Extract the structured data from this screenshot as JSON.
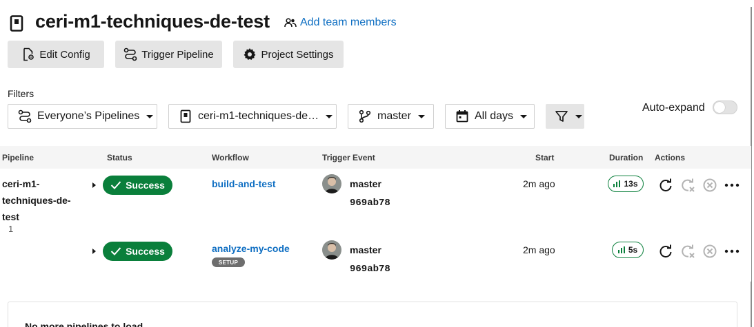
{
  "header": {
    "project_title": "ceri-m1-techniques-de-test",
    "add_team_label": "Add team members",
    "buttons": {
      "edit_config": "Edit Config",
      "trigger_pipeline": "Trigger Pipeline",
      "project_settings": "Project Settings"
    }
  },
  "filters": {
    "label": "Filters",
    "pipelines": "Everyone’s Pipelines",
    "project": "ceri-m1-techniques-de…",
    "branch": "master",
    "date": "All days",
    "auto_expand_label": "Auto-expand",
    "auto_expand_on": false
  },
  "table": {
    "columns": [
      "Pipeline",
      "Status",
      "Workflow",
      "Trigger Event",
      "Start",
      "Duration",
      "Actions"
    ],
    "pipeline": {
      "name_lines": [
        "ceri-m1-",
        "techniques-de-",
        "test"
      ],
      "number": "1"
    },
    "rows": [
      {
        "status": "Success",
        "workflow": "build-and-test",
        "badge": "",
        "branch": "master",
        "sha": "969ab78",
        "start": "2m ago",
        "duration": "13s"
      },
      {
        "status": "Success",
        "workflow": "analyze-my-code",
        "badge": "SETUP",
        "branch": "master",
        "sha": "969ab78",
        "start": "2m ago",
        "duration": "5s"
      }
    ]
  },
  "footer": {
    "no_more": "No more pipelines to load"
  },
  "colors": {
    "success": "#0a7f3b",
    "link": "#0e6ec2",
    "button_bg": "#e5e5e5"
  },
  "icons": [
    "project-icon",
    "people-icon",
    "file-gear-icon",
    "pipeline-icon",
    "gear-icon",
    "project-icon",
    "branch-icon",
    "calendar-icon",
    "filter-icon",
    "check-icon",
    "bar-chart-icon",
    "rerun-icon",
    "rerun-failed-icon",
    "cancel-icon",
    "more-icon"
  ]
}
